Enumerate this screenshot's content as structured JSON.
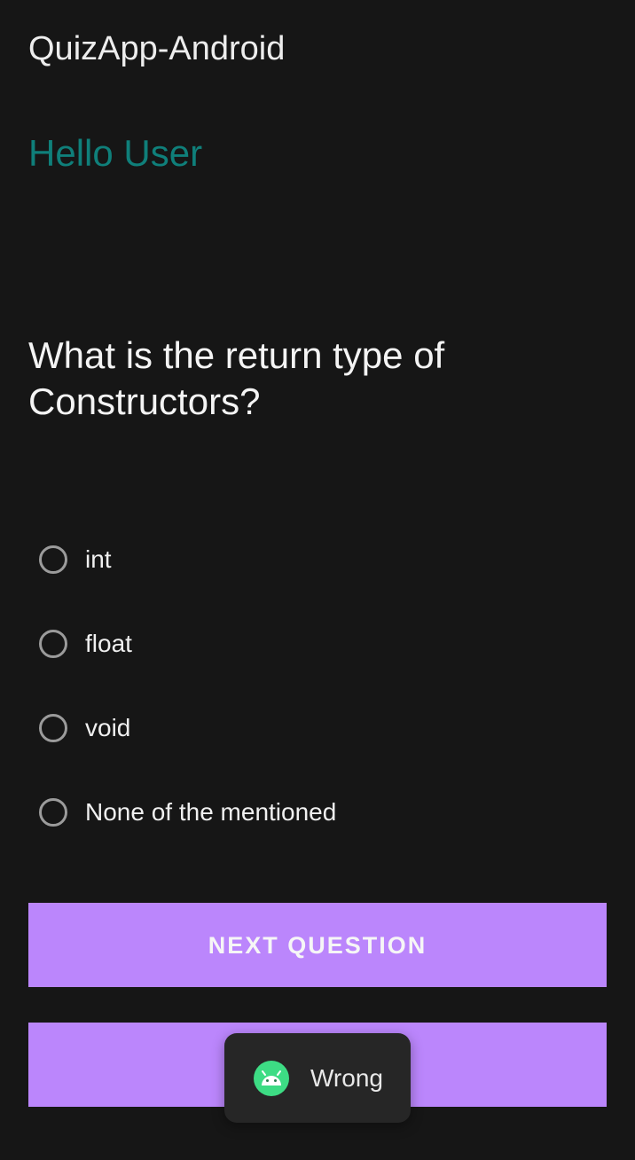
{
  "app_bar": {
    "title": "QuizApp-Android"
  },
  "greeting": {
    "text": "Hello User"
  },
  "question": {
    "text": "What is the return type of Constructors?"
  },
  "options": [
    {
      "label": "int"
    },
    {
      "label": "float"
    },
    {
      "label": "void"
    },
    {
      "label": "None of the mentioned"
    }
  ],
  "buttons": {
    "next_label": "NEXT QUESTION",
    "second_label": ""
  },
  "toast": {
    "icon": "android-icon",
    "message": "Wrong"
  },
  "colors": {
    "background": "#161616",
    "greeting": "#0f7f7a",
    "button": "#bb86fc",
    "toast_background": "#262626",
    "android_icon": "#3ddc84"
  }
}
